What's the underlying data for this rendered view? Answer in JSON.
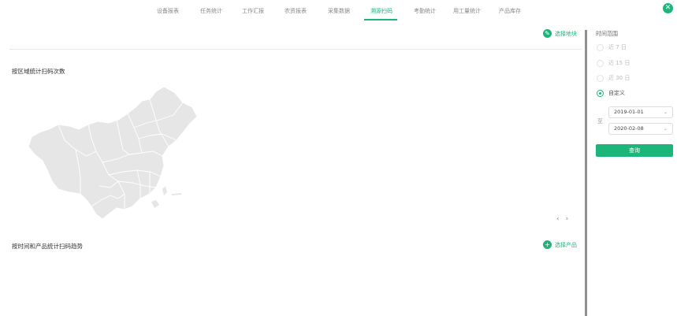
{
  "tabs": [
    {
      "label": "设备报表"
    },
    {
      "label": "任务统计"
    },
    {
      "label": "工作汇报"
    },
    {
      "label": "农资报表"
    },
    {
      "label": "采集数据"
    },
    {
      "label": "溯源扫码"
    },
    {
      "label": "考勤统计"
    },
    {
      "label": "用工量统计"
    },
    {
      "label": "产品库存"
    }
  ],
  "active_tab": "溯源扫码",
  "main": {
    "select_region_label": "选择地块",
    "region_section_title": "按区域统计扫码次数",
    "trend_section_title": "按时间和产品统计扫码趋势",
    "select_product_label": "选择产品",
    "pager_prev": "‹",
    "pager_next": "›",
    "map_icon": "china-map-icon"
  },
  "sidebar": {
    "time_range_title": "时间范围",
    "options": [
      {
        "label": "近 7 日",
        "checked": false
      },
      {
        "label": "近 15 日",
        "checked": false
      },
      {
        "label": "近 30 日",
        "checked": false
      },
      {
        "label": "自定义",
        "checked": true
      }
    ],
    "to_label": "至",
    "start_date": "2019-01-01",
    "end_date": "2020-02-08",
    "query_button": "查询"
  },
  "colors": {
    "accent": "#1db67a",
    "map_fill": "#e6e6e6",
    "map_border": "#ffffff"
  }
}
